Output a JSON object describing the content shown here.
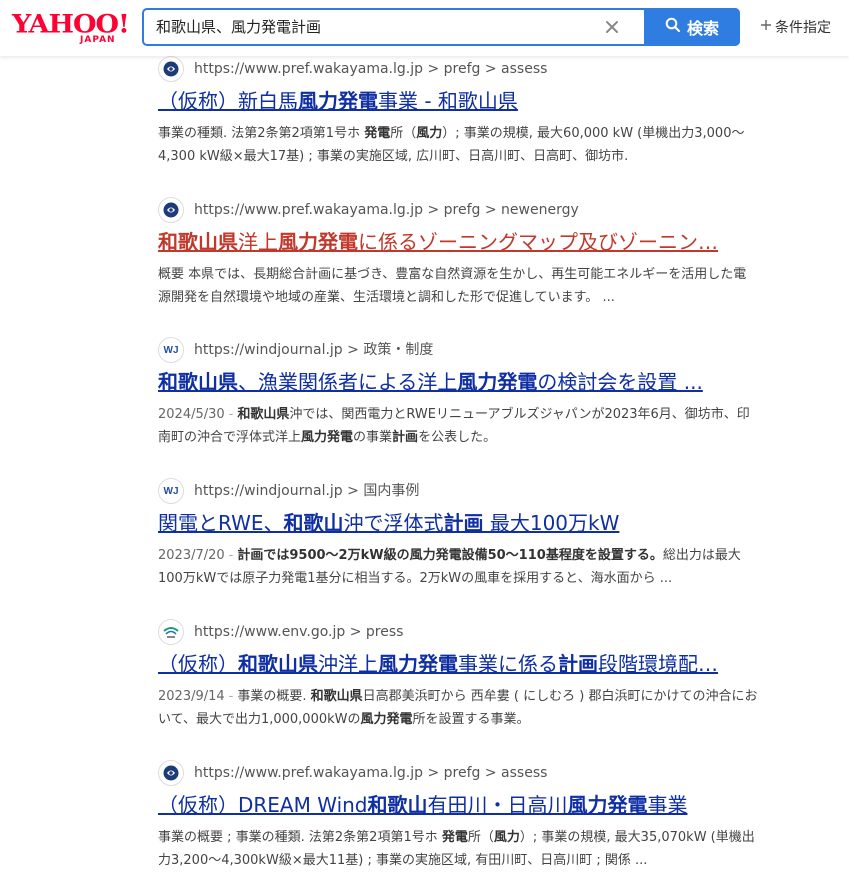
{
  "header": {
    "logo_main": "YAHOO!",
    "logo_sub": "JAPAN",
    "search_value": "和歌山県、風力発電計画",
    "search_button": "検索",
    "conditions": "条件指定"
  },
  "colors": {
    "accent": "#2f7de1",
    "link": "#0f2fa3",
    "visited": "#c0392b",
    "brand": "#ff0033"
  },
  "results": [
    {
      "favicon": "wakayama-pref-icon",
      "url": "https://www.pref.wakayama.lg.jp > prefg > assess",
      "title_parts": [
        [
          "（仮称）新白馬",
          0
        ],
        [
          "風力発電",
          1
        ],
        [
          "事業 - 和歌山県",
          0
        ]
      ],
      "snippet_parts": [
        [
          "事業の種類. 法第2条第2項第1号ホ ",
          0
        ],
        [
          "発電",
          1
        ],
        [
          "所（",
          0
        ],
        [
          "風力",
          1
        ],
        [
          "）; 事業の規模, 最大60,000 kW (単機出力3,000～4,300 kW級×最大17基) ; 事業の実施区域, 広川町、日高川町、日高町、御坊市.",
          0
        ]
      ]
    },
    {
      "favicon": "wakayama-pref-icon",
      "url": "https://www.pref.wakayama.lg.jp > prefg > newenergy",
      "visited": true,
      "title_parts": [
        [
          "和歌山県",
          1
        ],
        [
          "洋上",
          0
        ],
        [
          "風力発電",
          1
        ],
        [
          "に係るゾーニングマップ及びゾーニン…",
          0
        ]
      ],
      "snippet_parts": [
        [
          "概要 本県では、長期総合計画に基づき、豊富な自然資源を生かし、再生可能エネルギーを活用した電源開発を自然環境や地域の産業、生活環境と調和した形で促進しています。 ...",
          0
        ]
      ]
    },
    {
      "favicon": "windjournal-icon",
      "favicon_text": "WJ",
      "url": "https://windjournal.jp > 政策・制度",
      "title_parts": [
        [
          "和歌山県",
          1
        ],
        [
          "、漁業関係者による洋上",
          0
        ],
        [
          "風力発電",
          1
        ],
        [
          "の検討会を設置 ...",
          0
        ]
      ],
      "date": "2024/5/30",
      "snippet_parts": [
        [
          "和歌山県",
          1
        ],
        [
          "沖では、関西電力とRWEリニューアブルズジャパンが2023年6月、御坊市、印南町の沖合で浮体式洋上",
          0
        ],
        [
          "風力発電",
          1
        ],
        [
          "の事業",
          0
        ],
        [
          "計画",
          1
        ],
        [
          "を公表した。",
          0
        ]
      ]
    },
    {
      "favicon": "windjournal-icon",
      "favicon_text": "WJ",
      "url": "https://windjournal.jp > 国内事例",
      "title_parts": [
        [
          "関電とRWE、",
          0
        ],
        [
          "和歌山",
          1
        ],
        [
          "沖で浮体式",
          0
        ],
        [
          "計画",
          1
        ],
        [
          " 最大100万kW",
          0
        ]
      ],
      "date": "2023/7/20",
      "snippet_parts": [
        [
          "計画では9500～2万kW級の風力発電設備50～110基程度を設置する。",
          1
        ],
        [
          "総出力は最大100万kWでは原子力発電1基分に相当する。2万kWの風車を採用すると、海水面から ...",
          0
        ]
      ]
    },
    {
      "favicon": "env-go-icon",
      "url": "https://www.env.go.jp > press",
      "title_parts": [
        [
          "（仮称）",
          0
        ],
        [
          "和歌山県",
          1
        ],
        [
          "沖洋上",
          0
        ],
        [
          "風力発電",
          1
        ],
        [
          "事業に係る",
          0
        ],
        [
          "計画",
          1
        ],
        [
          "段階環境配…",
          0
        ]
      ],
      "date": "2023/9/14",
      "snippet_parts": [
        [
          "事業の概要. ",
          0
        ],
        [
          "和歌山県",
          1
        ],
        [
          "日高郡美浜町から 西牟婁 ( にしむろ ) 郡白浜町にかけての沖合において、最大で出力1,000,000kWの",
          0
        ],
        [
          "風力発電",
          1
        ],
        [
          "所を設置する事業。",
          0
        ]
      ]
    },
    {
      "favicon": "wakayama-pref-icon",
      "url": "https://www.pref.wakayama.lg.jp > prefg > assess",
      "title_parts": [
        [
          "（仮称）DREAM Wind",
          0
        ],
        [
          "和歌山",
          1
        ],
        [
          "有田川・日高川",
          0
        ],
        [
          "風力発電",
          1
        ],
        [
          "事業",
          0
        ]
      ],
      "snippet_parts": [
        [
          "事業の概要 ; 事業の種類. 法第2条第2項第1号ホ ",
          0
        ],
        [
          "発電",
          1
        ],
        [
          "所（",
          0
        ],
        [
          "風力",
          1
        ],
        [
          "）; 事業の規模, 最大35,070kW (単機出力3,200～4,300kW級×最大11基) ; 事業の実施区域, 有田川町、日高川町 ; 関係 ...",
          0
        ]
      ]
    }
  ]
}
